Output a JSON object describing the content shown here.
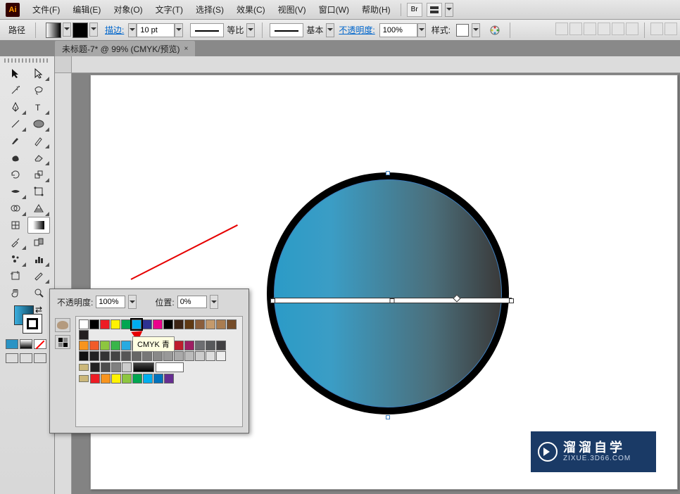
{
  "app_logo": "Ai",
  "menu": [
    "文件(F)",
    "编辑(E)",
    "对象(O)",
    "文字(T)",
    "选择(S)",
    "效果(C)",
    "视图(V)",
    "窗口(W)",
    "帮助(H)"
  ],
  "menu_badge": "Br",
  "ctrl": {
    "mode": "路径",
    "stroke_label": "描边:",
    "stroke_value": "10 pt",
    "profile_label": "等比",
    "basic_label": "基本",
    "opacity_label": "不透明度:",
    "opacity_value": "100%",
    "style_label": "样式:"
  },
  "tab": {
    "title": "未标题-7* @ 99% (CMYK/预览)"
  },
  "popup": {
    "opacity_label": "不透明度:",
    "opacity_value": "100%",
    "position_label": "位置:",
    "position_value": "0%"
  },
  "tooltip": "CMYK 青",
  "swatch_rows": {
    "r1": [
      "#ffffff",
      "#000000",
      "#ed1c24",
      "#fff200",
      "#00a651",
      "#00aeef",
      "#2e3192",
      "#ec008c",
      "#000000",
      "#3c2415",
      "#603913",
      "#8b5e3c",
      "#c49a6c",
      "#a97c50",
      "#754c29",
      "#231f20"
    ],
    "r2": [
      "#f7941d",
      "#f15a29",
      "#8dc63f",
      "#39b54a",
      "#27aae1",
      "#1c75bc",
      "#662d91",
      "#92278f",
      "#da1c5c",
      "#be1e2d",
      "#9e1f63",
      "#6d6e71",
      "#58595b",
      "#414042"
    ],
    "gray": [
      "#111",
      "#222",
      "#333",
      "#444",
      "#555",
      "#666",
      "#777",
      "#888",
      "#999",
      "#aaa",
      "#bbb",
      "#ccc",
      "#ddd",
      "#eee"
    ],
    "folder1": [
      "#222",
      "#4d4d4d",
      "#808080",
      "#cccccc"
    ],
    "folder2": [
      "#ed1c24",
      "#f7941d",
      "#fff200",
      "#8dc63f",
      "#00a651",
      "#00aeef",
      "#0072bc",
      "#662d91"
    ]
  },
  "watermark": {
    "main": "溜溜自学",
    "sub": "ZIXUE.3D66.COM"
  },
  "chart_data": null
}
